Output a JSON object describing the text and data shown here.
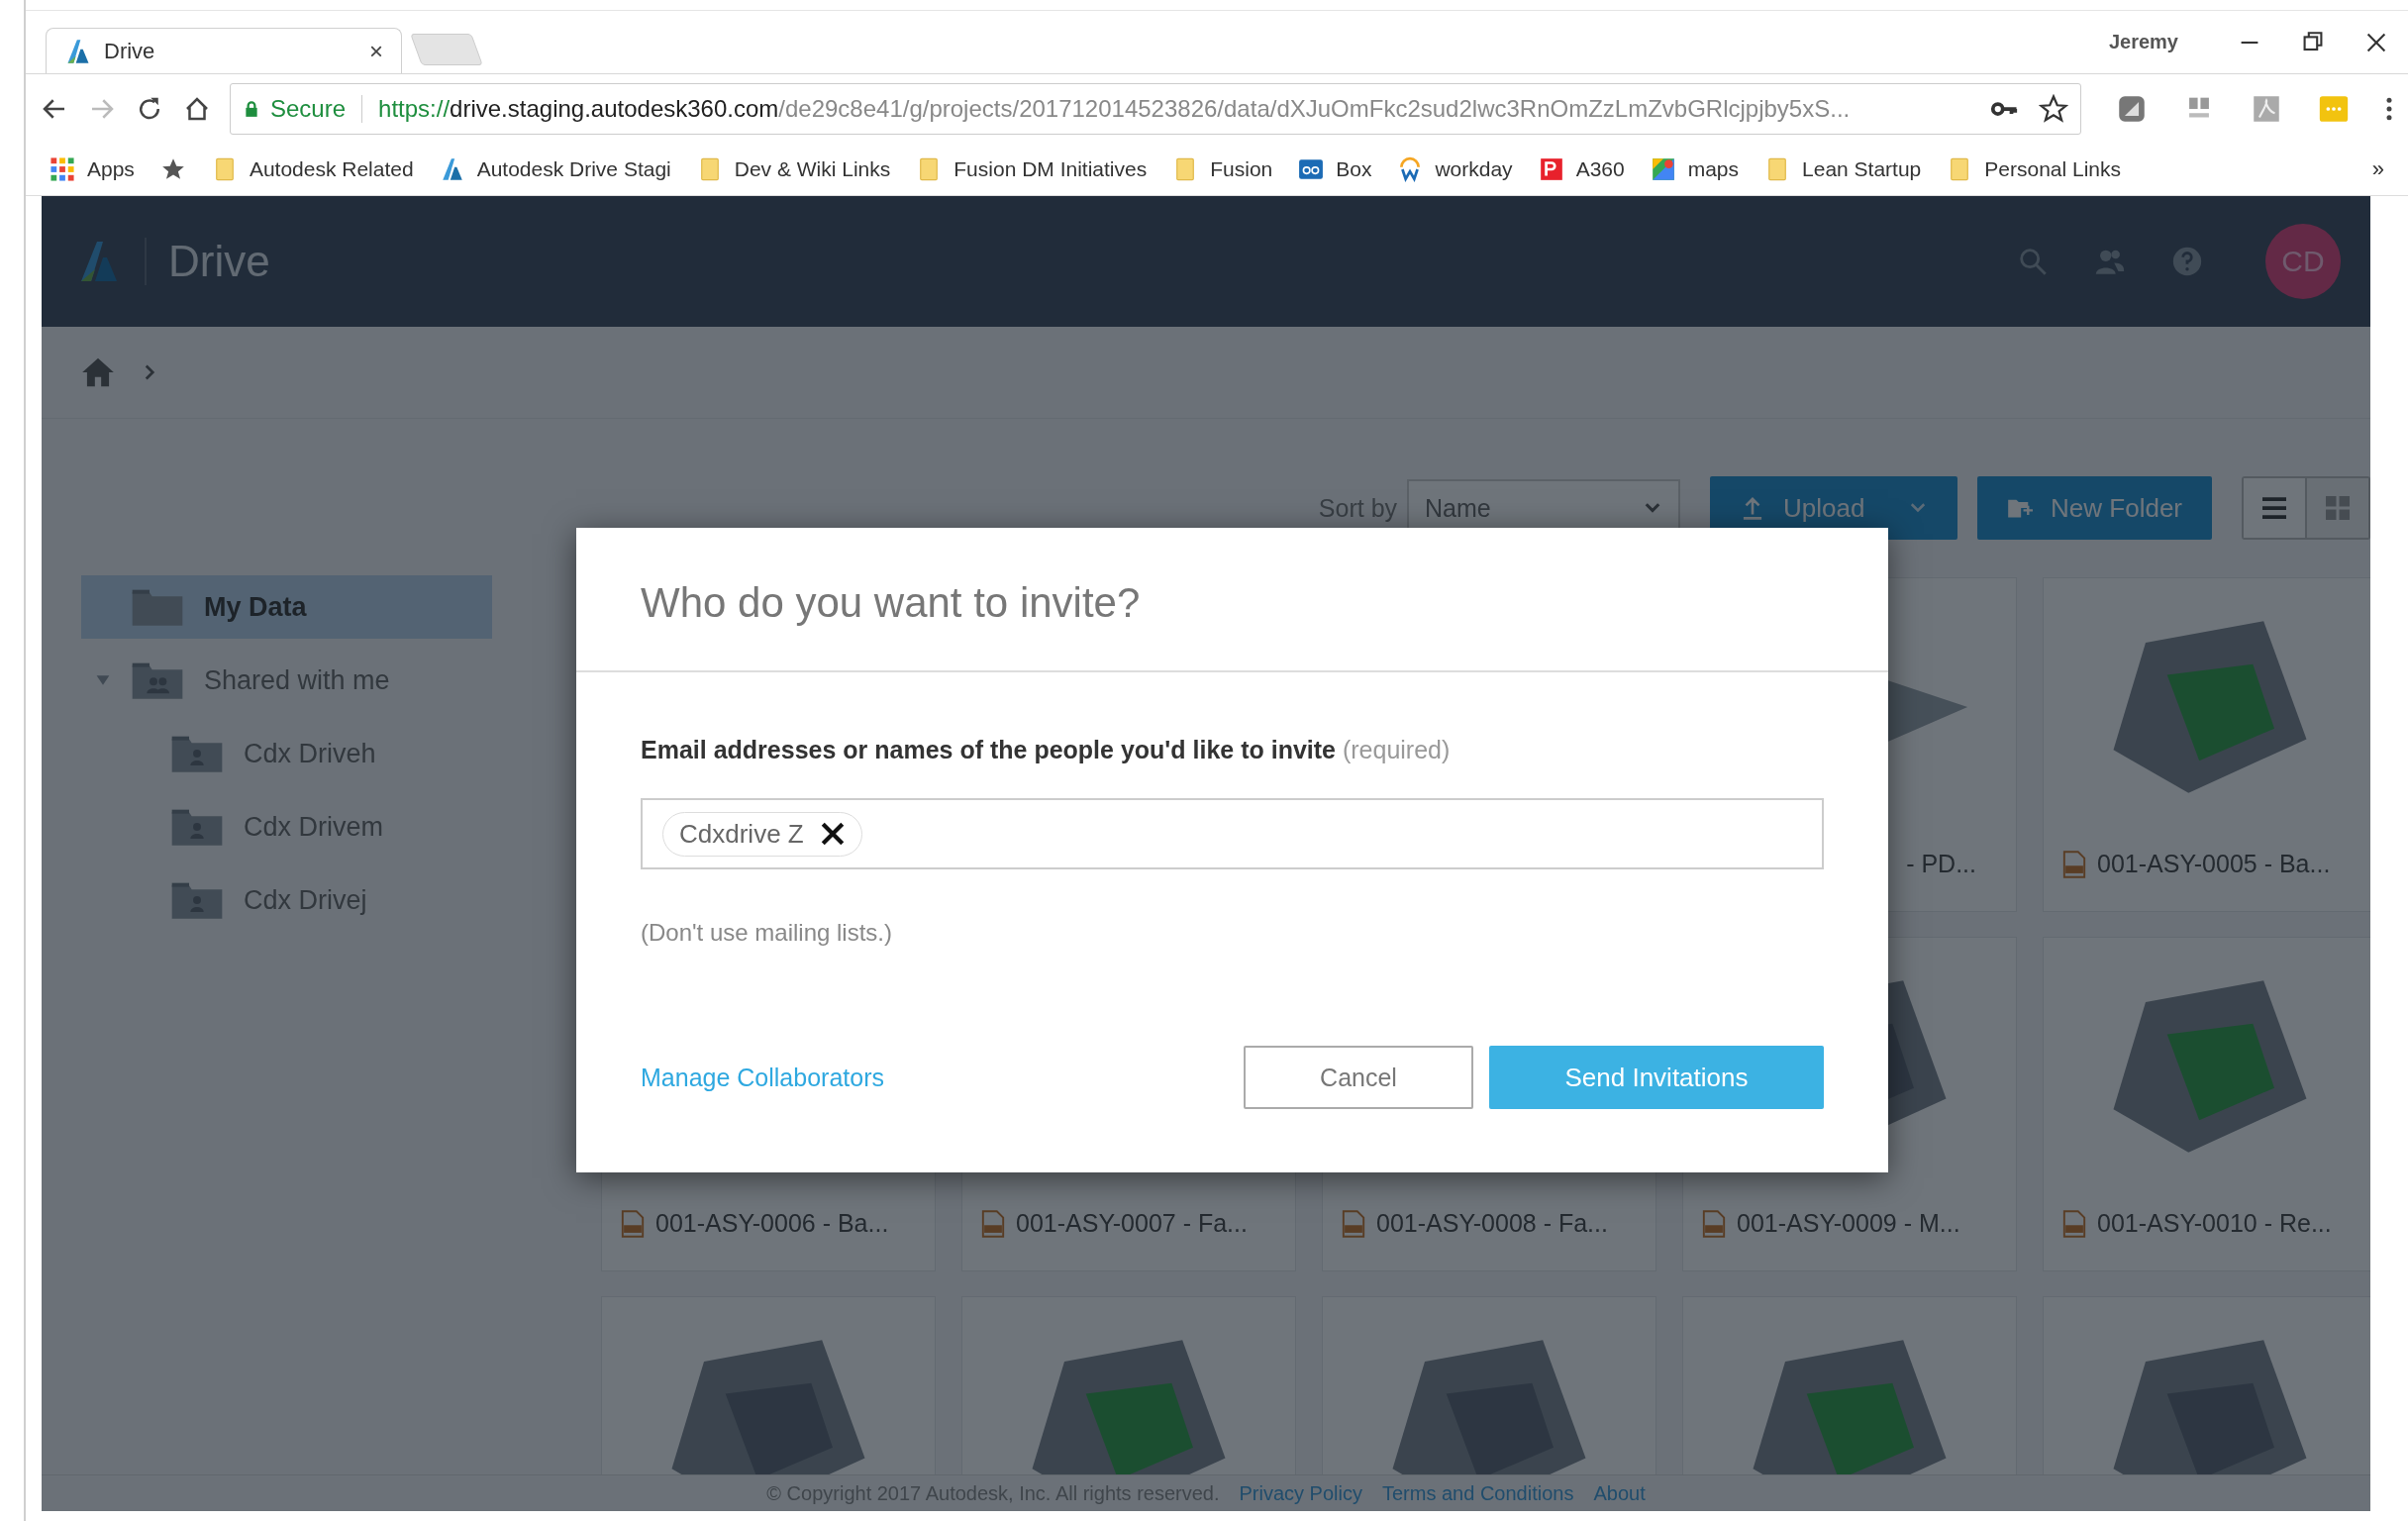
{
  "browser": {
    "tab": {
      "title": "Drive",
      "close": "×"
    },
    "profile": "Jeremy",
    "address": {
      "secure_label": "Secure",
      "scheme": "https://",
      "host": "drive.staging.autodesk360.com",
      "path": "/de29c8e41/g/projects/201712014523826/data/dXJuOmFkc2sud2lwc3RnOmZzLmZvbGRlcjpjby5xS..."
    },
    "bookmarks": [
      {
        "label": "Apps",
        "kind": "apps"
      },
      {
        "kind": "star"
      },
      {
        "label": "Autodesk Related",
        "kind": "folder"
      },
      {
        "label": "Autodesk Drive Stagi",
        "kind": "autodesk"
      },
      {
        "label": "Dev & Wiki Links",
        "kind": "folder"
      },
      {
        "label": "Fusion DM Initiatives",
        "kind": "folder"
      },
      {
        "label": "Fusion",
        "kind": "folder"
      },
      {
        "label": "Box",
        "kind": "box"
      },
      {
        "label": "workday",
        "kind": "workday"
      },
      {
        "label": "A360",
        "kind": "a360"
      },
      {
        "label": "maps",
        "kind": "maps"
      },
      {
        "label": "Lean Startup",
        "kind": "folder"
      },
      {
        "label": "Personal Links",
        "kind": "folder"
      }
    ],
    "more": "»"
  },
  "app": {
    "title": "Drive",
    "avatar": "CD",
    "sidebar": [
      {
        "label": "My Data",
        "selected": true,
        "kind": "folder"
      },
      {
        "label": "Shared with me",
        "selected": false,
        "kind": "shared",
        "expanded": true,
        "children": [
          {
            "label": "Cdx Driveh",
            "selected": false,
            "kind": "person"
          },
          {
            "label": "Cdx Drivem",
            "selected": false,
            "kind": "person"
          },
          {
            "label": "Cdx Drivej",
            "selected": false,
            "kind": "person"
          }
        ]
      }
    ],
    "toolbar": {
      "sort_label": "Sort by",
      "sort_value": "Name",
      "upload": "Upload",
      "new_folder": "New Folder",
      "views": [
        {
          "kind": "list",
          "selected": true
        },
        {
          "kind": "grid",
          "selected": false
        }
      ]
    },
    "files": [
      [
        {
          "kind": "partial",
          "label": "- PD..."
        },
        {
          "kind": "model",
          "label": "001-ASY-0005 - Ba..."
        }
      ],
      [
        {
          "kind": "model",
          "label": "001-ASY-0006 - Ba..."
        },
        {
          "kind": "model",
          "label": "001-ASY-0007 - Fa..."
        },
        {
          "kind": "model",
          "label": "001-ASY-0008 - Fa..."
        },
        {
          "kind": "model",
          "label": "001-ASY-0009 - M..."
        },
        {
          "kind": "model",
          "label": "001-ASY-0010 - Re..."
        }
      ],
      [
        {
          "kind": "thumb"
        },
        {
          "kind": "thumb"
        },
        {
          "kind": "thumb"
        },
        {
          "kind": "thumb"
        },
        {
          "kind": "thumb"
        }
      ]
    ],
    "footer": {
      "copyright": "© Copyright 2017 Autodesk, Inc. All rights reserved.",
      "links": [
        "Privacy Policy",
        "Terms and Conditions",
        "About"
      ]
    }
  },
  "dialog": {
    "title": "Who do you want to invite?",
    "field_label": "**Email addresses or names of the people you'd like to invite** (required)",
    "chips": [
      "Cdxdrive Z"
    ],
    "hint": "(Don't use mailing lists.)",
    "link": "Manage Collaborators",
    "cancel": "Cancel",
    "send": "Send Invitations"
  }
}
